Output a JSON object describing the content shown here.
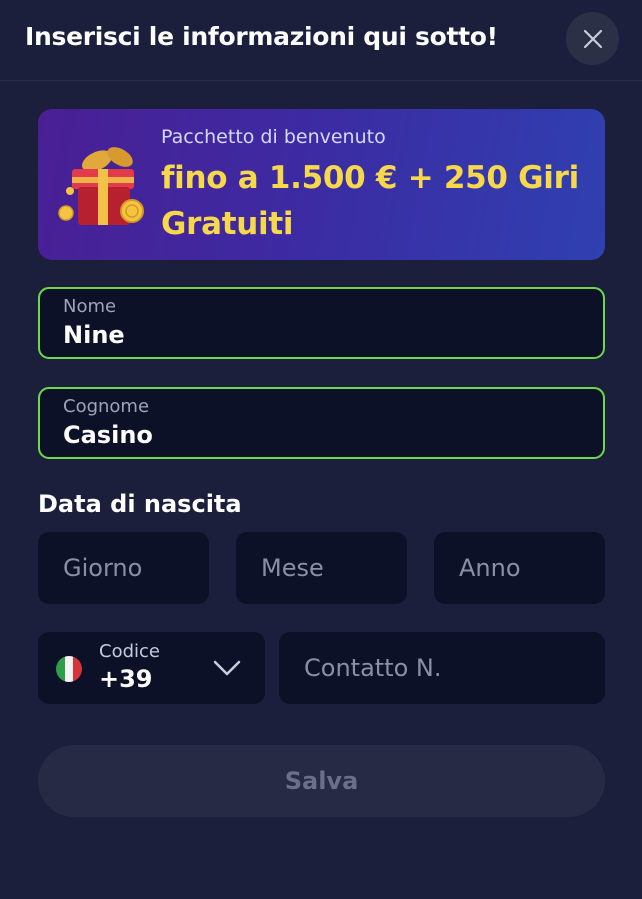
{
  "header": {
    "title": "Inserisci le informazioni qui sotto!",
    "close_icon": "close-icon"
  },
  "banner": {
    "subtitle": "Pacchetto di benvenuto",
    "title": "fino a 1.500 € + 250 Giri Gratuiti",
    "icon": "gift-icon",
    "accent_color": "#f7d84a"
  },
  "form": {
    "first_name": {
      "label": "Nome",
      "value": "Nine"
    },
    "last_name": {
      "label": "Cognome",
      "value": "Casino"
    },
    "birth_date": {
      "label": "Data di nascita",
      "day_placeholder": "Giorno",
      "month_placeholder": "Mese",
      "year_placeholder": "Anno"
    },
    "phone": {
      "code_label": "Codice",
      "code_value": "+39",
      "flag_icon": "italy-flag-icon",
      "number_placeholder": "Contatto N."
    },
    "save_label": "Salva"
  },
  "colors": {
    "background": "#1b1f3b",
    "field_background": "#0d1128",
    "valid_border": "#6fd84a"
  }
}
